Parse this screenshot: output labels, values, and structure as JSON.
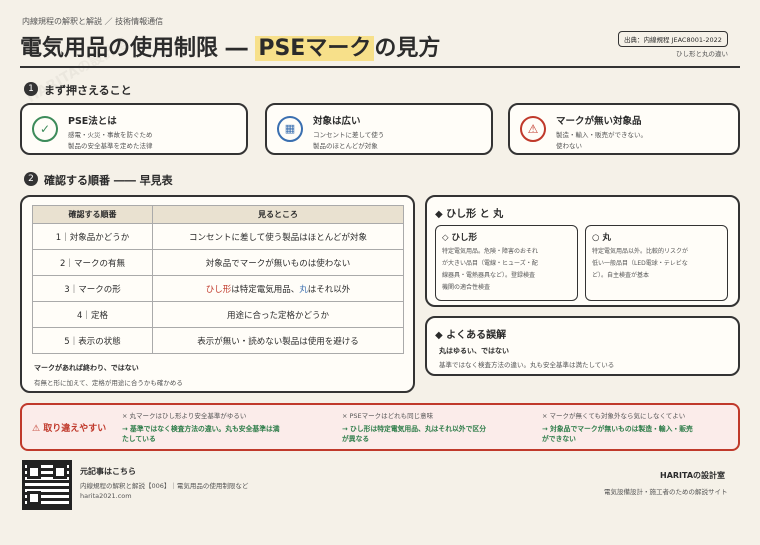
{
  "header": {
    "series": "内線規程の解釈と解説 ／ 技術情報通信",
    "title": "電気用品の使用制限 ― ",
    "title_hl": "PSEマーク",
    "title_tail": "の見方",
    "source": "出典：内線規程 JEAC8001-2022",
    "subtitle": "ひし形と丸の違い"
  },
  "sec1": {
    "num": "1",
    "title": "まず押さえること",
    "cards": [
      {
        "title": "PSE法とは",
        "l1": "感電・火災・事故を防ぐため",
        "l2": "製品の安全基準を定めた法律",
        "icon": "shield-check-icon",
        "color": "#3d8b5a"
      },
      {
        "title": "対象は広い",
        "l1": "コンセントに差して使う",
        "l2": "製品のほとんどが対象",
        "icon": "calculator-icon",
        "color": "#3a6fb0"
      },
      {
        "title": "マークが無い対象品",
        "l1": "製造・輸入・販売ができない。",
        "l2": "使わない",
        "icon": "warning-icon",
        "color": "#c0392b"
      }
    ]
  },
  "sec2": {
    "num": "2",
    "title": "確認する順番 ―― 早見表",
    "th1": "確認する順番",
    "th2": "見るところ",
    "rows": [
      {
        "a": "1｜対象品かどうか",
        "b": "コンセントに差して使う製品はほとんどが対象"
      },
      {
        "a": "2｜マークの有無",
        "b": "対象品でマークが無いものは使わない"
      },
      {
        "a": "3｜マークの形",
        "b1": "ひし形",
        "b2": "は特定電気用品、",
        "b3": "丸",
        "b4": "はそれ以外"
      },
      {
        "a": "4｜定格",
        "b": "用途に合った定格かどうか"
      },
      {
        "a": "5｜表示の状態",
        "b": "表示が無い・読めない製品は使用を避ける"
      }
    ],
    "note1": "マークがあれば終わり、ではない",
    "note2": "有無と形に加えて、定格が用途に合うかも確かめる"
  },
  "shapes": {
    "title": "◆ ひし形 と 丸",
    "diamond": {
      "title": "◇ ひし形",
      "l1": "特定電気用品。危険・障害のおそれ",
      "l2": "が大きい品目（電線・ヒューズ・配",
      "l3": "線器具・電熱器具など）。登録検査",
      "l4": "機関の適合性検査"
    },
    "circle": {
      "title": "○ 丸",
      "l1": "特定電気用品以外。比較的リスクが",
      "l2": "低い一般品目（LED電球・テレビな",
      "l3": "ど）。自主検査が基本"
    }
  },
  "faq": {
    "title": "◆ よくある誤解",
    "q": "丸はゆるい、ではない",
    "a": "基準ではなく検査方法の違い。丸も安全基準は満たしている"
  },
  "mistakes": {
    "label": "取り違えやすい",
    "items": [
      {
        "wrong": "× 丸マークはひし形より安全基準がゆるい",
        "r1": "→ 基準ではなく検査方法の違い。丸も安全基準は満",
        "r2": "たしている"
      },
      {
        "wrong": "× PSEマークはどれも同じ意味",
        "r1": "→ ひし形は特定電気用品、丸はそれ以外で区分",
        "r2": "が異なる"
      },
      {
        "wrong": "× マークが無くても対象外なら気にしなくてよい",
        "r1": "→ 対象品でマークが無いものは製造・輸入・販売",
        "r2": "ができない"
      }
    ]
  },
  "footer": {
    "t1": "元記事はこちら",
    "t2": "内線規程の解釈と解説【006】｜電気用品の使用制限など",
    "t3": "harita2021.com",
    "brand": "HARITAの設計室",
    "brand_sub": "電気設備設計・施工者のための解説サイト"
  },
  "watermark": "HARITAの設計室"
}
